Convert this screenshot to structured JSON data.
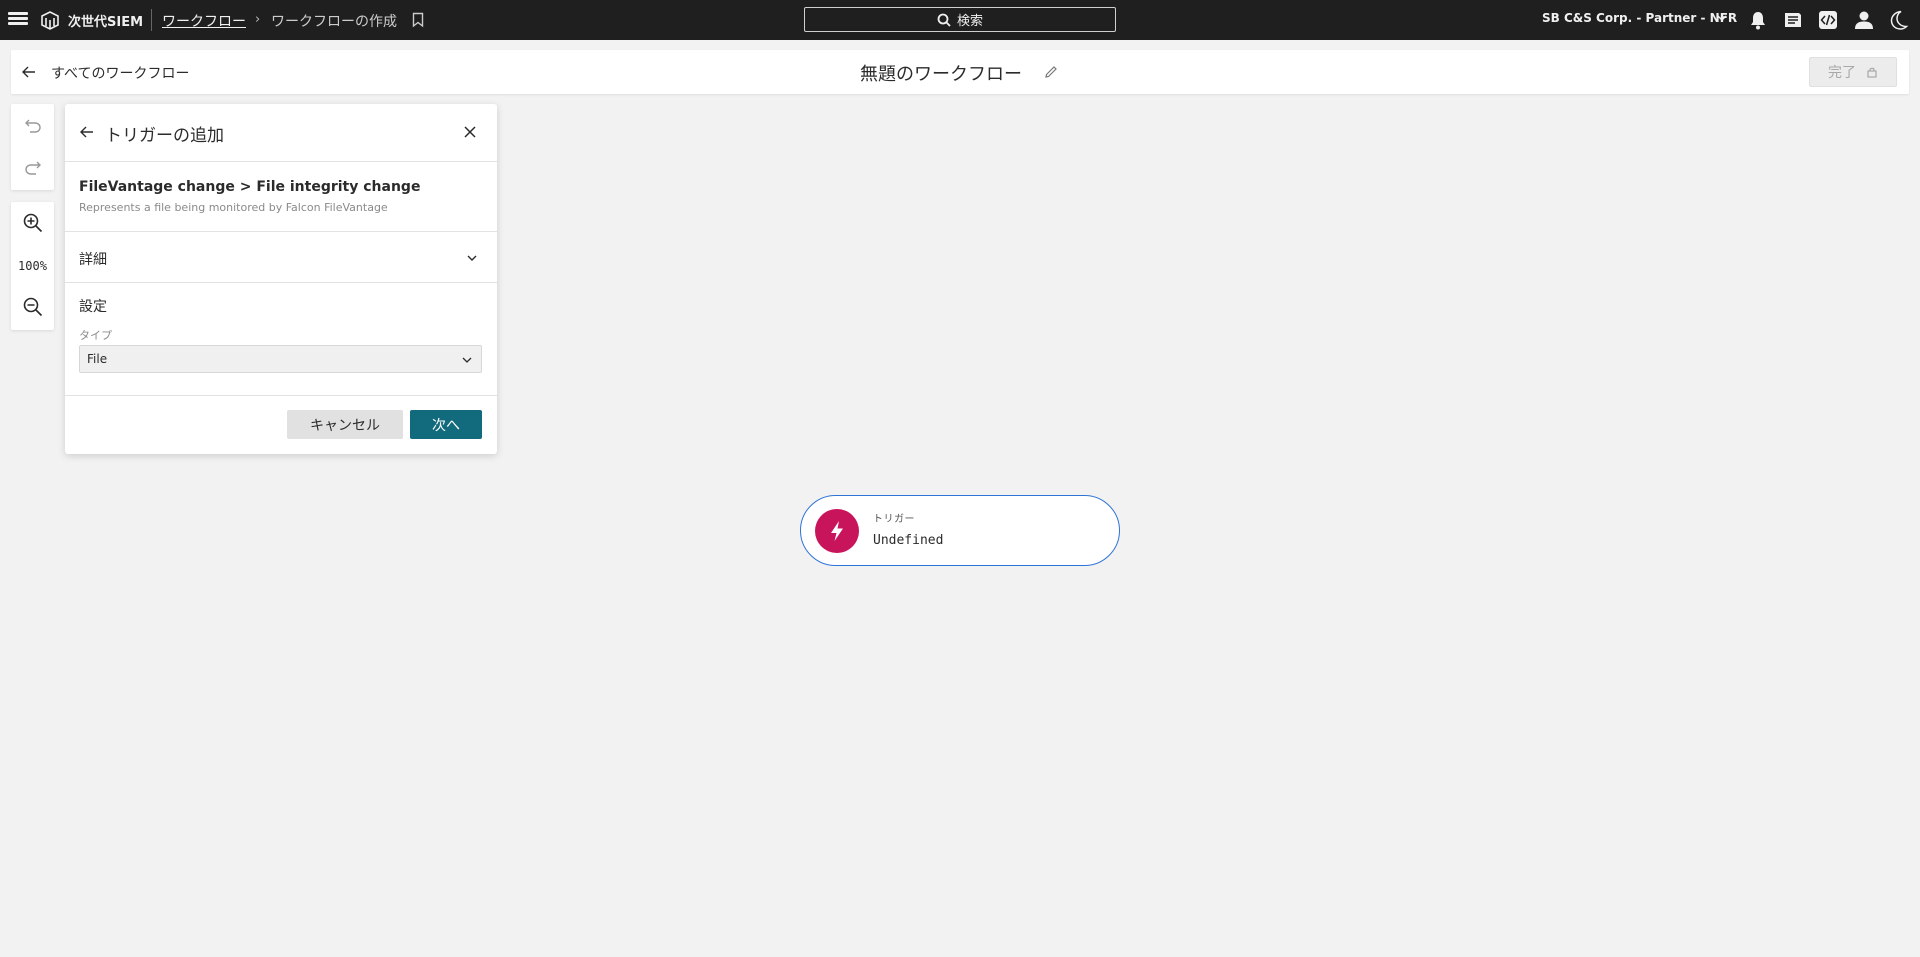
{
  "topbar": {
    "brand": "次世代SIEM",
    "breadcrumb_parent": "ワークフロー",
    "breadcrumb_current": "ワークフローの作成",
    "search_label": "検索",
    "org_name": "SB C&S Corp. - Partner - NFR",
    "icons": [
      "menu-icon",
      "logo-icon",
      "bookmark-icon",
      "search-icon",
      "chevron-down-icon",
      "bell-icon",
      "news-icon",
      "code-icon",
      "user-icon",
      "moon-icon"
    ]
  },
  "subheader": {
    "back_label": "すべてのワークフロー",
    "workflow_title": "無題のワークフロー",
    "done_label": "完了"
  },
  "canvas_tools": {
    "zoom_level": "100%"
  },
  "panel": {
    "title": "トリガーの追加",
    "trigger_path": "FileVantage change > File integrity change",
    "trigger_description": "Represents a file being monitored by Falcon FileVantage",
    "details_label": "詳細",
    "settings_label": "設定",
    "type_label": "タイプ",
    "type_value": "File",
    "cancel_label": "キャンセル",
    "next_label": "次へ"
  },
  "trigger_node": {
    "label": "トリガー",
    "value": "Undefined",
    "color": "#c8145a"
  },
  "colors": {
    "topbar_bg": "#1f1f1f",
    "primary_button": "#126a7d",
    "node_border": "#2f73d8",
    "trigger_accent": "#c8145a"
  }
}
